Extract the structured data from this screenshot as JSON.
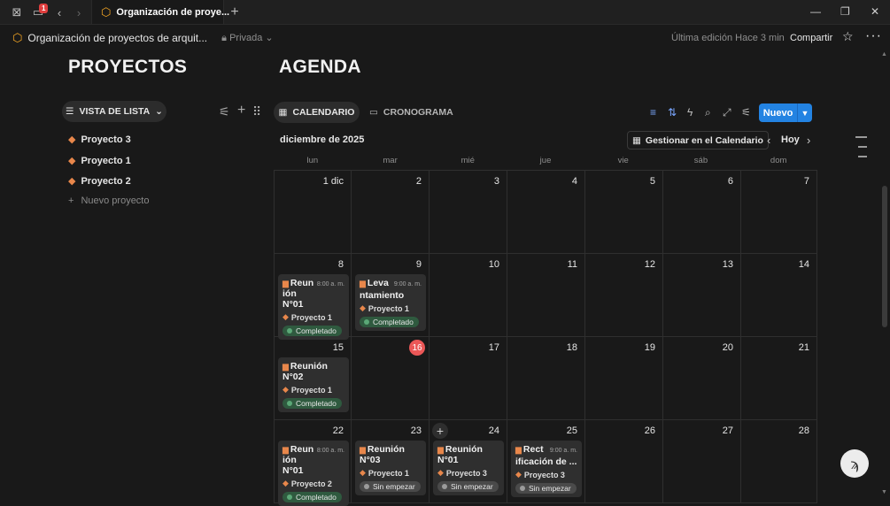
{
  "window": {
    "tab_title": "Organización de proye...",
    "notification_count": "1",
    "icons": [
      "page-icon",
      "sidebar-icon",
      "back-icon",
      "forward-icon",
      "new-tab-icon",
      "minimize-icon",
      "restore-icon",
      "close-icon"
    ]
  },
  "header": {
    "breadcrumb": "Organización de proyectos de arquit...",
    "privacy": "Privada",
    "last_edit": "Última edición Hace 3 min",
    "share": "Compartir"
  },
  "projects": {
    "title": "PROYECTOS",
    "view_label": "VISTA DE LISTA",
    "items": [
      "Proyecto 3",
      "Proyecto 1",
      "Proyecto 2"
    ],
    "new_item": "Nuevo proyecto"
  },
  "agenda": {
    "title": "AGENDA",
    "tabs": [
      "CALENDARIO",
      "CRONOGRAMA"
    ],
    "new_button": "Nuevo",
    "month": "diciembre de 2025",
    "manage": "Gestionar en el Calendario",
    "today": "Hoy",
    "weekdays": [
      "lun",
      "mar",
      "mié",
      "jue",
      "vie",
      "sáb",
      "dom"
    ],
    "today_date": "16",
    "accent": "#2383e2",
    "today_color": "#eb5757",
    "weeks": [
      [
        {
          "day": "1 dic"
        },
        {
          "day": "2"
        },
        {
          "day": "3"
        },
        {
          "day": "4"
        },
        {
          "day": "5"
        },
        {
          "day": "6"
        },
        {
          "day": "7"
        }
      ],
      [
        {
          "day": "8",
          "events": [
            {
              "title": "Reun ión N°01",
              "time": "8:00 a. m.",
              "project": "Proyecto 1",
              "status": "Completado",
              "done": true
            }
          ]
        },
        {
          "day": "9",
          "events": [
            {
              "title": "Leva ntamiento",
              "time": "9:00 a. m.",
              "project": "Proyecto 1",
              "status": "Completado",
              "done": true
            }
          ]
        },
        {
          "day": "10"
        },
        {
          "day": "11"
        },
        {
          "day": "12"
        },
        {
          "day": "13"
        },
        {
          "day": "14"
        }
      ],
      [
        {
          "day": "15",
          "events": [
            {
              "title": "Reunión N°02",
              "time": "",
              "project": "Proyecto 1",
              "status": "Completado",
              "done": true
            }
          ]
        },
        {
          "day": "16",
          "today": true
        },
        {
          "day": "17"
        },
        {
          "day": "18"
        },
        {
          "day": "19"
        },
        {
          "day": "20"
        },
        {
          "day": "21"
        }
      ],
      [
        {
          "day": "22",
          "events": [
            {
              "title": "Reun ión N°01",
              "time": "8:00 a. m.",
              "project": "Proyecto 2",
              "status": "Completado",
              "done": true
            }
          ]
        },
        {
          "day": "23",
          "events": [
            {
              "title": "Reunión N°03",
              "time": "",
              "project": "Proyecto 1",
              "status": "Sin empezar",
              "done": false
            }
          ]
        },
        {
          "day": "24",
          "add": true,
          "events": [
            {
              "title": "Reunión N°01",
              "time": "",
              "project": "Proyecto 3",
              "status": "Sin empezar",
              "done": false
            }
          ]
        },
        {
          "day": "25",
          "events": [
            {
              "title": "Rect ificación de ...",
              "time": "9:00 a. m.",
              "project": "Proyecto 3",
              "status": "Sin empezar",
              "done": false
            }
          ]
        },
        {
          "day": "26"
        },
        {
          "day": "27"
        },
        {
          "day": "28"
        }
      ]
    ]
  }
}
